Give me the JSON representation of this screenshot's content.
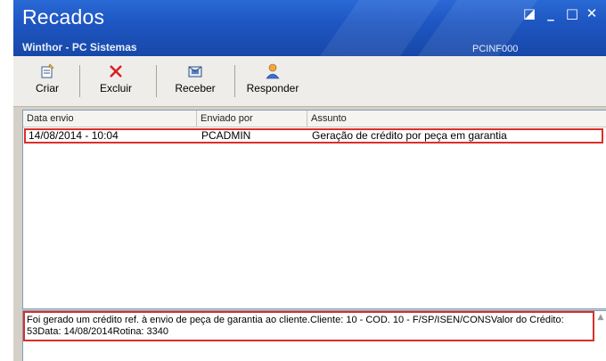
{
  "window": {
    "title": "Recados",
    "subtitle": "Winthor - PC Sistemas",
    "code": "PCINF000",
    "controls": {
      "restore": "◪",
      "minimize": "_",
      "maximize": "□",
      "close": "✕"
    }
  },
  "toolbar": {
    "buttons": [
      {
        "label": "Criar",
        "icon": "new-message-icon"
      },
      {
        "label": "Excluir",
        "icon": "delete-x-icon"
      },
      {
        "label": "Receber",
        "icon": "receive-message-icon"
      },
      {
        "label": "Responder",
        "icon": "reply-user-icon"
      }
    ]
  },
  "table": {
    "headers": [
      "Data envio",
      "Enviado por",
      "Assunto"
    ],
    "rows": [
      [
        "14/08/2014 - 10:04",
        "PCADMIN",
        "Geração de crédito por peça em garantia"
      ]
    ]
  },
  "message": {
    "text": "Foi gerado um crédito ref. à envio de peça de garantia ao cliente.Cliente: 10 - COD. 10 - F/SP/ISEN/CONSValor do Crédito: 53Data: 14/08/2014Rotina: 3340"
  },
  "colors": {
    "titlebar": "#1e56c2",
    "highlight": "#d9302a",
    "window_bg": "#d4d0c8"
  }
}
